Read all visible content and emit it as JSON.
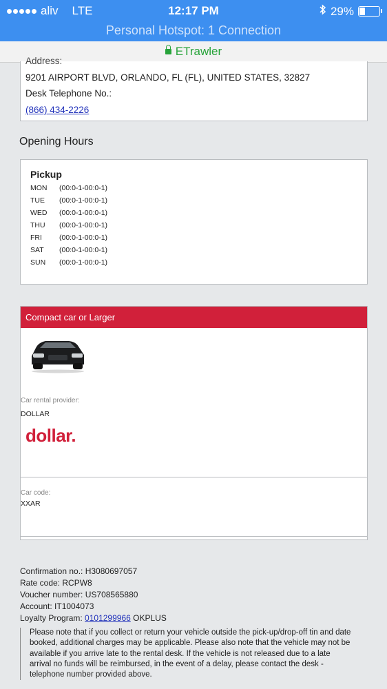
{
  "status": {
    "carrier": "aliv",
    "network": "LTE",
    "time": "12:17 PM",
    "battery": "29%",
    "hotspot": "Personal Hotspot: 1 Connection"
  },
  "browser": {
    "site": "ETrawler",
    "secure_color": "#27a33a"
  },
  "address": {
    "label_cut": "Address:",
    "value": "9201 AIRPORT BLVD, ORLANDO, FL (FL), UNITED STATES, 32827",
    "phone_label": "Desk Telephone No.:",
    "phone": "(866) 434-2226"
  },
  "opening_hours": {
    "title": "Opening Hours",
    "pickup_title": "Pickup",
    "rows": [
      {
        "day": "MON",
        "hours": "(00:0-1-00:0-1)"
      },
      {
        "day": "TUE",
        "hours": "(00:0-1-00:0-1)"
      },
      {
        "day": "WED",
        "hours": "(00:0-1-00:0-1)"
      },
      {
        "day": "THU",
        "hours": "(00:0-1-00:0-1)"
      },
      {
        "day": "FRI",
        "hours": "(00:0-1-00:0-1)"
      },
      {
        "day": "SAT",
        "hours": "(00:0-1-00:0-1)"
      },
      {
        "day": "SUN",
        "hours": "(00:0-1-00:0-1)"
      }
    ]
  },
  "car": {
    "header": "Compact car or Larger",
    "header_color": "#d1203a",
    "provider_label": "Car rental provider:",
    "provider": "DOLLAR",
    "logo_text": "dollar.",
    "code_label": "Car code:",
    "code": "XXAR"
  },
  "booking": {
    "confirmation": "Confirmation no.: H3080697057",
    "rate_code": "Rate code: RCPW8",
    "voucher": "Voucher number: US708565880",
    "account": "Account: IT1004073",
    "loyalty_label": "Loyalty Program: ",
    "loyalty_number": "0101299966",
    "loyalty_suffix": " OKPLUS"
  },
  "note": "Please note that if you collect or return your vehicle outside the pick-up/drop-off tin and date booked, additional charges may be applicable. Please also note that the vehicle may not be available if you arrive late to the rental desk. If the vehicle is not released due to a late arrival no funds will be reimbursed, in the event of a delay, please contact the desk - telephone number provided above."
}
